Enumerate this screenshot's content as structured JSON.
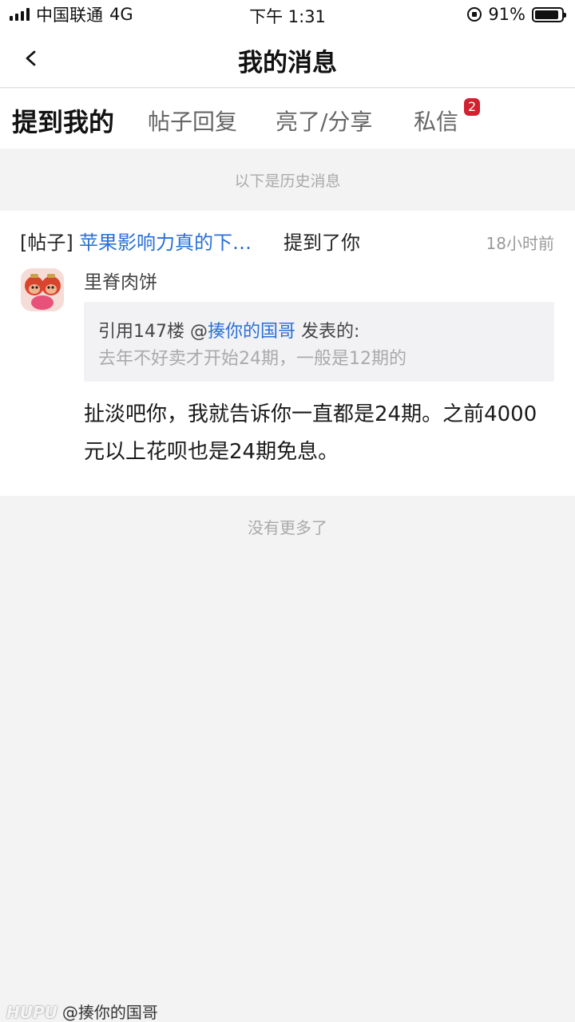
{
  "status_bar": {
    "carrier": "中国联通",
    "network": "4G",
    "time": "下午 1:31",
    "battery_percent": "91%",
    "battery_level": 0.91
  },
  "nav": {
    "title": "我的消息",
    "back_icon": "chevron-left-icon"
  },
  "tabs": [
    {
      "label": "提到我的",
      "active": true
    },
    {
      "label": "帖子回复",
      "active": false
    },
    {
      "label": "亮了/分享",
      "active": false
    },
    {
      "label": "私信",
      "active": false,
      "badge": "2"
    }
  ],
  "history_label": "以下是历史消息",
  "message": {
    "type": "[帖子]",
    "post_title": "苹果影响力真的下…",
    "action": "提到了你",
    "time": "18小时前",
    "username": "里脊肉饼",
    "quote": {
      "prefix": "引用147楼 @",
      "user": "揍你的国哥",
      "suffix": " 发表的:",
      "text": "去年不好卖才开始24期，一般是12期的"
    },
    "reply": "扯淡吧你，我就告诉你一直都是24期。之前4000元以上花呗也是24期免息。"
  },
  "no_more": "没有更多了",
  "watermark": {
    "brand": "HUPU",
    "handle": "@揍你的国哥"
  },
  "colors": {
    "link": "#2a6fd6",
    "badge": "#d22030",
    "background": "#f3f3f4"
  }
}
